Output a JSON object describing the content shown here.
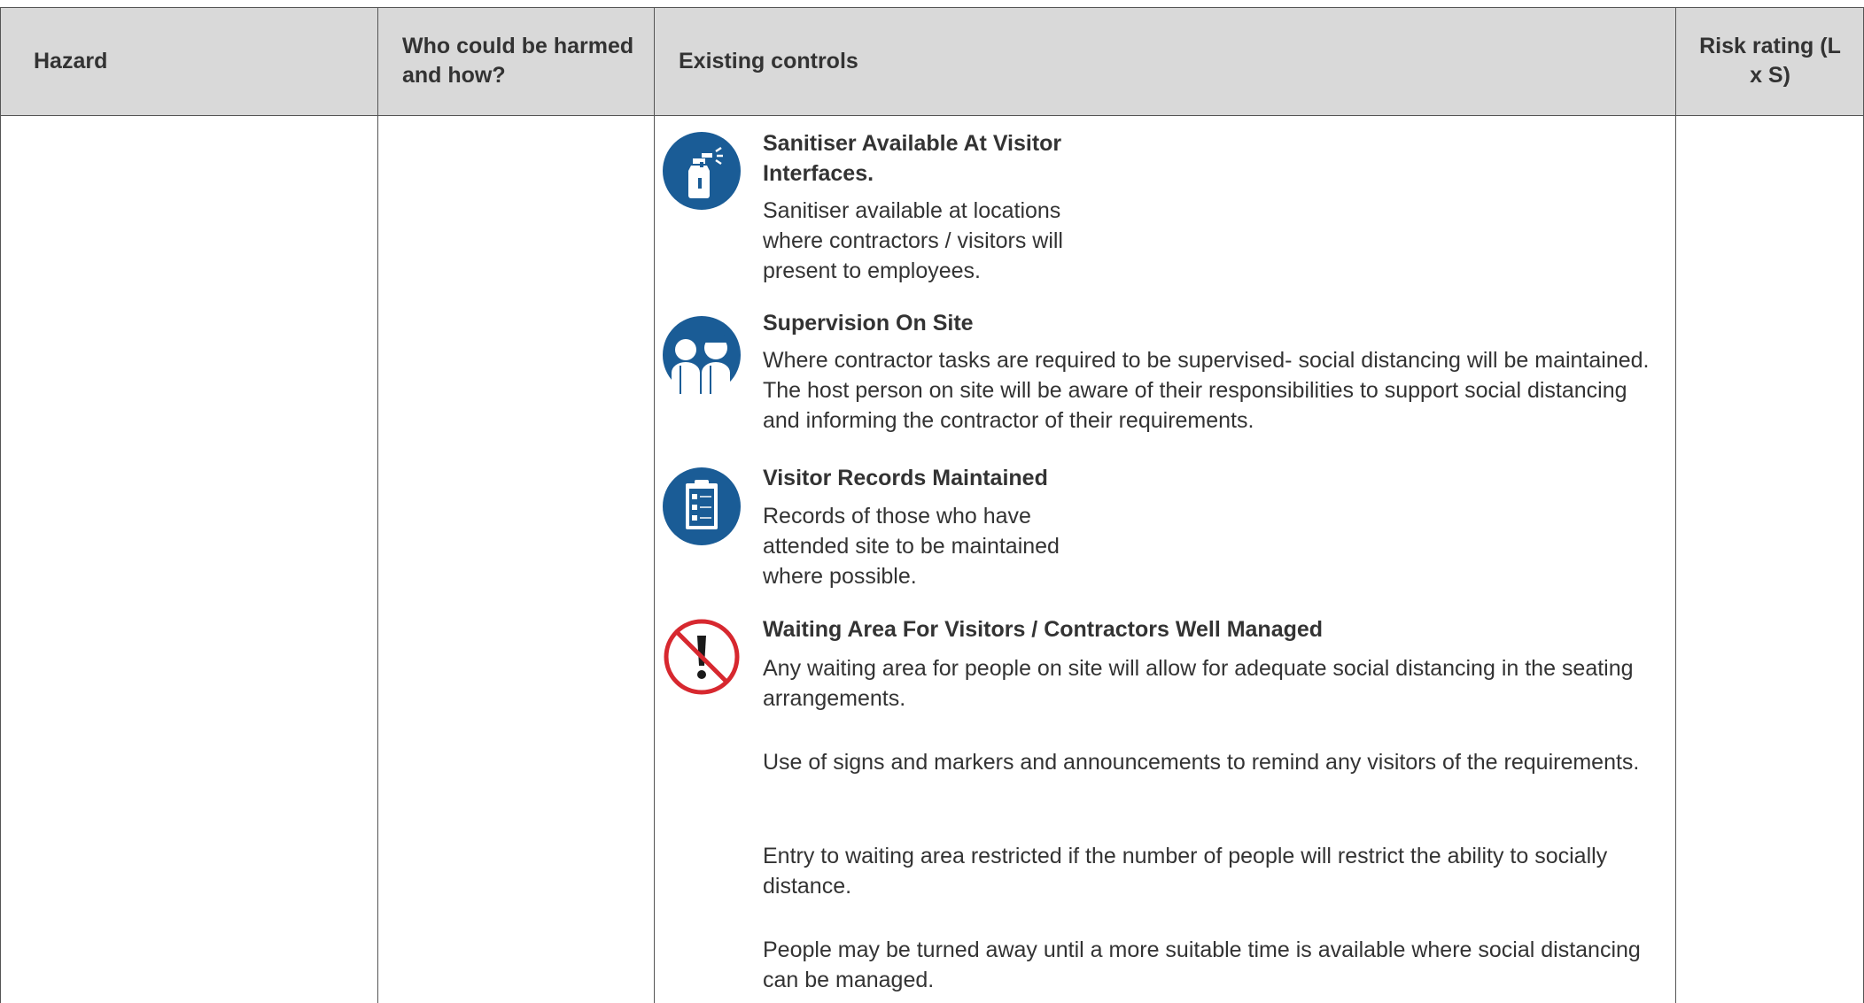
{
  "table": {
    "columns": [
      {
        "label": "Hazard"
      },
      {
        "label": "Who could be harmed and how?"
      },
      {
        "label": "Existing controls"
      },
      {
        "label": "Risk rating (L x S)"
      }
    ],
    "controls": [
      {
        "icon": "spray-bottle-icon",
        "title": "Sanitiser Available At Visitor Interfaces.",
        "paragraphs": [
          "Sanitiser available at locations where contractors / visitors will present to employees."
        ]
      },
      {
        "icon": "supervisor-people-icon",
        "title": "Supervision On Site",
        "paragraphs": [
          "Where contractor tasks are required to be supervised- social distancing will be maintained. The host person on site will be aware of their responsibilities to support social distancing and informing the contractor of their requirements."
        ]
      },
      {
        "icon": "clipboard-checklist-icon",
        "title": "Visitor Records Maintained",
        "paragraphs": [
          "Records of those who have attended site to be maintained where possible."
        ]
      },
      {
        "icon": "prohibition-warning-icon",
        "title": "Waiting Area For Visitors / Contractors Well Managed",
        "paragraphs": [
          "Any waiting area for people on site will allow for adequate social distancing in the seating arrangements.",
          "Use of signs and markers and announcements to remind any visitors of the requirements.",
          "Entry to waiting area restricted if the number of people will restrict the ability to socially distance.",
          "People may be turned away until a more suitable time is available where social distancing can be managed."
        ]
      }
    ],
    "colors": {
      "header_bg": "#d9d9d9",
      "icon_blue": "#1a5c96",
      "prohibition_red": "#d7282f",
      "border": "#555555"
    }
  }
}
